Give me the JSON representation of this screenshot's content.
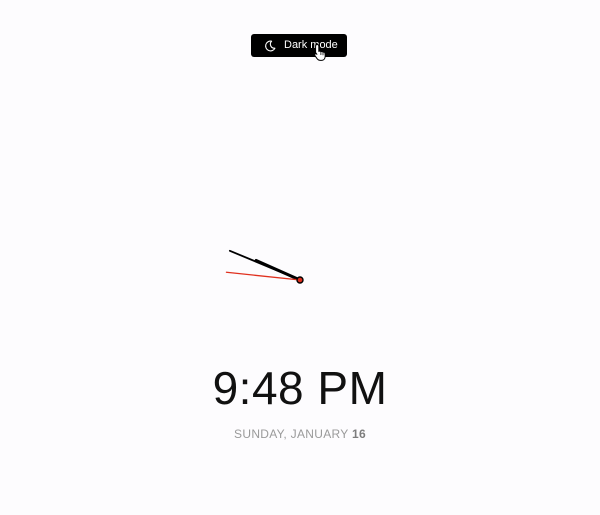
{
  "toggle": {
    "label": "Dark mode",
    "icon": "moon-icon"
  },
  "clock": {
    "hour": 9,
    "minute": 48,
    "second": 46,
    "hand_color": "#000000",
    "second_hand_color": "#e0301e"
  },
  "time_display": "9:48 PM",
  "date": {
    "prefix": "SUNDAY, JANUARY ",
    "day": "16"
  }
}
